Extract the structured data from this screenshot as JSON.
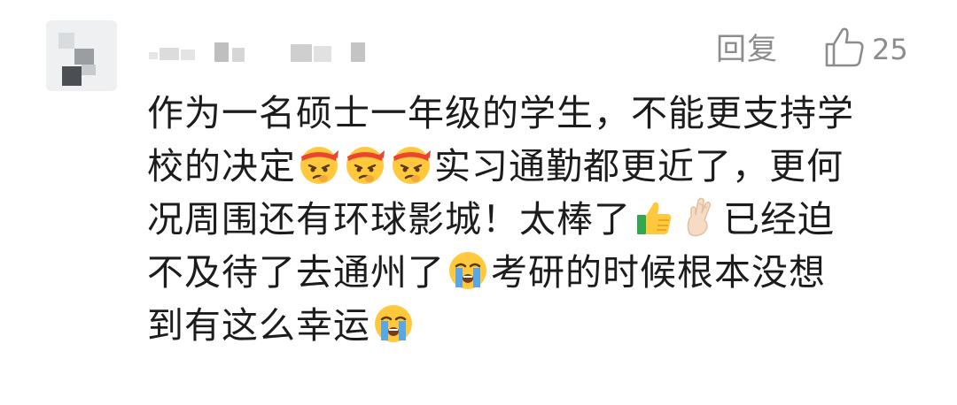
{
  "comment": {
    "author_name": "",
    "reply_label": "回复",
    "like_count": "25",
    "lines": [
      [
        "作为一名硕士一年级的学生，不能更支持学"
      ],
      [
        "校的决定",
        "emoji:pouting-headband",
        "emoji:pouting-headband",
        "emoji:pouting-headband",
        "实习通勤都更近了，更何"
      ],
      [
        "况周围还有环球影城！太棒了",
        "emoji:thumbs-up",
        "emoji:crossed-fingers",
        "已经迫"
      ],
      [
        "不及待了去通州了",
        "emoji:crying-face",
        "考研的时候根本没想"
      ],
      [
        "到有这么幸运",
        "emoji:crying-face"
      ]
    ],
    "icons": {
      "like": "thumbs-up-outline-icon"
    },
    "colors": {
      "text": "#1c1c1c",
      "meta": "#8c8c8c",
      "background": "#ffffff"
    }
  }
}
